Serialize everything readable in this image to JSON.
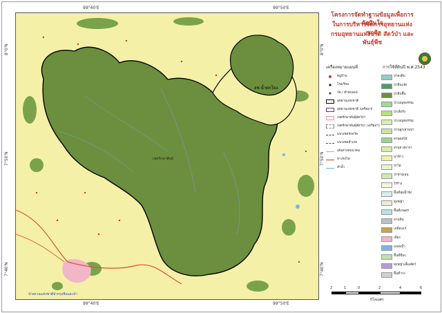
{
  "map": {
    "top_coords": [
      "99°40'E",
      "99°50'E"
    ],
    "bottom_coords": [
      "99°40'E",
      "99°50'E"
    ],
    "left_coords": [
      "8°0'N",
      "7°50'N",
      "7°40'N"
    ],
    "right_coords": [
      "8°0'N",
      "7°50'N",
      "7°40'N"
    ],
    "labels": {
      "park_name": "อช.น้ำตกโยง",
      "center_name": "เขตรักษาพันธุ์",
      "bottom_note": "ป่าสงวนแห่งชาติป่ากรุงชิงและป่า"
    },
    "colors": {
      "background": "#f5f0a8",
      "forest": "#6b8f3e",
      "boundary": "#000000",
      "urban": "#f2b6c8",
      "water": "#7fb3e0"
    }
  },
  "panel": {
    "title_lines": [
      "โครงการจัดทำฐานข้อมูลเพื่อการตัดสินใจ",
      "ในการบริหารจัดการอุทยานแห่งชาติ",
      "กรมอุทยานแห่งชาติ สัตว์ป่า และพันธุ์พืช"
    ],
    "legend_left_heading": "เครื่องหมายแผนที่",
    "legend_right_heading": "การใช้ที่ดินปี พ.ศ.2543",
    "legend_left": [
      {
        "label": "หมู่บ้าน",
        "kind": "dot-red"
      },
      {
        "label": "โรงเรียน",
        "kind": "school"
      },
      {
        "label": "วัด / สำนักสงฆ์",
        "kind": "temple"
      },
      {
        "label": "อุทยานแห่งชาติ",
        "kind": "box-black"
      },
      {
        "label": "อุทยานแห่งชาติ (เตรียมฯ)",
        "kind": "box-purple"
      },
      {
        "label": "เขตรักษาพันธุ์สัตว์ป่า",
        "kind": "box-pink"
      },
      {
        "label": "เขตรักษาพันธุ์สัตว์ป่า (เตรียมฯ)",
        "kind": "box-gray"
      },
      {
        "label": "แนวเขตจังหวัด",
        "kind": "line-dashdot"
      },
      {
        "label": "แนวเขตอำเภอ",
        "kind": "line-dash"
      },
      {
        "label": "เส้นทางคมนาคม",
        "kind": "line-road"
      },
      {
        "label": "ทางรถไฟ",
        "kind": "line-rail"
      },
      {
        "label": "ลำน้ำ",
        "kind": "line-water"
      }
    ],
    "legend_right": [
      {
        "label": "ป่าดงดิบ",
        "color": "#8fd0c8"
      },
      {
        "label": "ป่าดิบแล้ง",
        "color": "#4f9a6a"
      },
      {
        "label": "ป่าดิบชื้น",
        "color": "#6b8f3e"
      },
      {
        "label": "ป่าเบญจพรรณ",
        "color": "#a3d69a"
      },
      {
        "label": "ป่าเต็งรัง",
        "color": "#b7e07a"
      },
      {
        "label": "ป่าเบญจพรรณ",
        "color": "#d6efb4"
      },
      {
        "label": "ป่าปลูก/สวนป่า",
        "color": "#c7e5a0"
      },
      {
        "label": "สวนผลไม้",
        "color": "#9dd18f"
      },
      {
        "label": "สวนยางพารา",
        "color": "#d6ef9c"
      },
      {
        "label": "นาข้าว",
        "color": "#f5f0a8"
      },
      {
        "label": "ป่าไผ่",
        "color": "#e8f2d6"
      },
      {
        "label": "ป่าชายเลน",
        "color": "#cfe8b8"
      },
      {
        "label": "ไร่ร้าง",
        "color": "#f0f6e0"
      },
      {
        "label": "พื้นที่ลุ่มน้ำขัง",
        "color": "#d8eef0"
      },
      {
        "label": "ทุ่งหญ้า",
        "color": "#e6f0d0"
      },
      {
        "label": "พื้นที่เกษตร",
        "color": "#b8e0e8"
      },
      {
        "label": "ลานหิน",
        "color": "#b8c0c8"
      },
      {
        "label": "เหมืองแร่",
        "color": "#c8a050"
      },
      {
        "label": "เมือง",
        "color": "#f2b6c8"
      },
      {
        "label": "แหล่งน้ำ",
        "color": "#7fb3e0"
      },
      {
        "label": "พื้นที่อื่นๆ",
        "color": "#bfe0b0"
      },
      {
        "label": "ทุ่งหญ้าเลี้ยงสัตว์",
        "color": "#b89ad8"
      },
      {
        "label": "พื้นที่ว่าง",
        "color": "#d0d0d0"
      }
    ],
    "scale": {
      "ticks": [
        "2",
        "1",
        "0",
        "2",
        "4",
        "6"
      ],
      "unit": "กิโลเมตร"
    }
  }
}
